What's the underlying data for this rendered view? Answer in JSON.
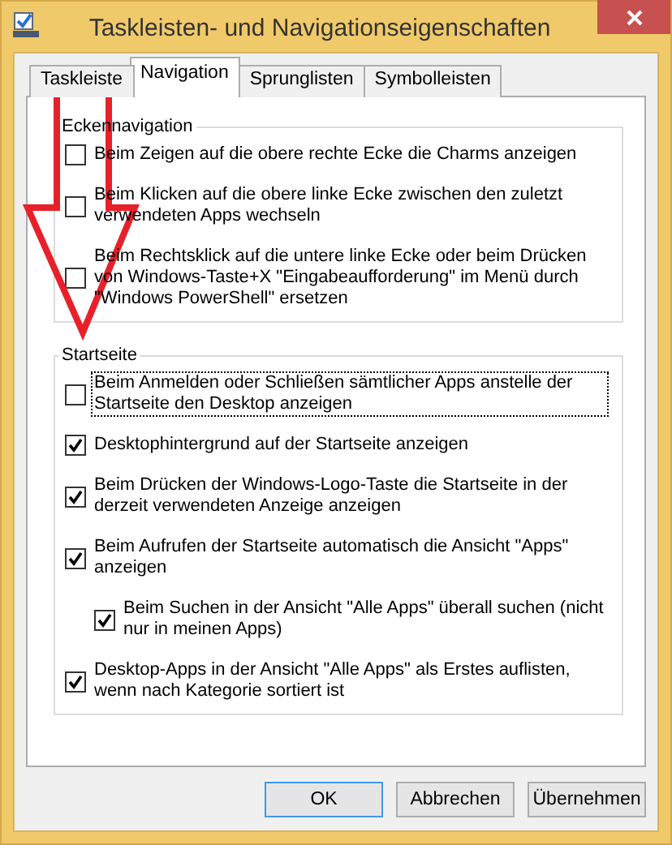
{
  "window": {
    "title": "Taskleisten- und Navigationseigenschaften"
  },
  "tabs": [
    {
      "label": "Taskleiste",
      "selected": false
    },
    {
      "label": "Navigation",
      "selected": true
    },
    {
      "label": "Sprunglisten",
      "selected": false
    },
    {
      "label": "Symbolleisten",
      "selected": false
    }
  ],
  "groups": [
    {
      "title": "Eckennavigation",
      "options": [
        {
          "label": "Beim Zeigen auf die obere rechte Ecke die Charms anzeigen",
          "checked": false,
          "focused": false
        },
        {
          "label": "Beim Klicken auf die obere linke Ecke zwischen den zuletzt verwendeten Apps wechseln",
          "checked": false,
          "focused": false
        },
        {
          "label": "Beim Rechtsklick auf die untere linke Ecke oder beim Drücken von Windows-Taste+X \"Eingabeaufforderung\" im Menü durch \"Windows PowerShell\" ersetzen",
          "checked": false,
          "focused": false
        }
      ]
    },
    {
      "title": "Startseite",
      "options": [
        {
          "label": "Beim Anmelden oder Schließen sämtlicher Apps anstelle der Startseite den Desktop anzeigen",
          "checked": false,
          "focused": true
        },
        {
          "label": "Desktophintergrund auf der Startseite anzeigen",
          "checked": true,
          "focused": false
        },
        {
          "label": "Beim Drücken der Windows-Logo-Taste die Startseite in der derzeit verwendeten Anzeige anzeigen",
          "checked": true,
          "focused": false
        },
        {
          "label": "Beim Aufrufen der Startseite automatisch die Ansicht \"Apps\" anzeigen",
          "checked": true,
          "focused": false,
          "children": [
            {
              "label": "Beim Suchen in der Ansicht \"Alle Apps\" überall suchen (nicht nur in meinen Apps)",
              "checked": true,
              "focused": false
            }
          ]
        },
        {
          "label": "Desktop-Apps in der Ansicht \"Alle Apps\" als Erstes auflisten, wenn nach Kategorie sortiert ist",
          "checked": true,
          "focused": false
        }
      ]
    }
  ],
  "buttons": [
    {
      "label": "OK",
      "default": true
    },
    {
      "label": "Abbrechen",
      "default": false
    },
    {
      "label": "Übernehmen",
      "default": false
    }
  ]
}
